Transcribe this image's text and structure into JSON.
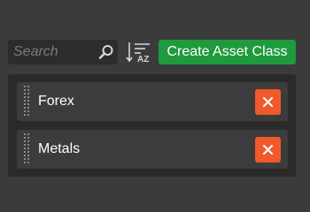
{
  "search": {
    "placeholder": "Search",
    "icon": "search-icon"
  },
  "sort": {
    "icon": "sort-alphabetical-icon",
    "letters": "AZ"
  },
  "create_button": {
    "label": "Create Asset Class",
    "color": "#1f9a3c"
  },
  "asset_classes": [
    {
      "label": "Forex"
    },
    {
      "label": "Metals"
    }
  ],
  "delete": {
    "icon": "close-icon",
    "color": "#f0592a"
  }
}
